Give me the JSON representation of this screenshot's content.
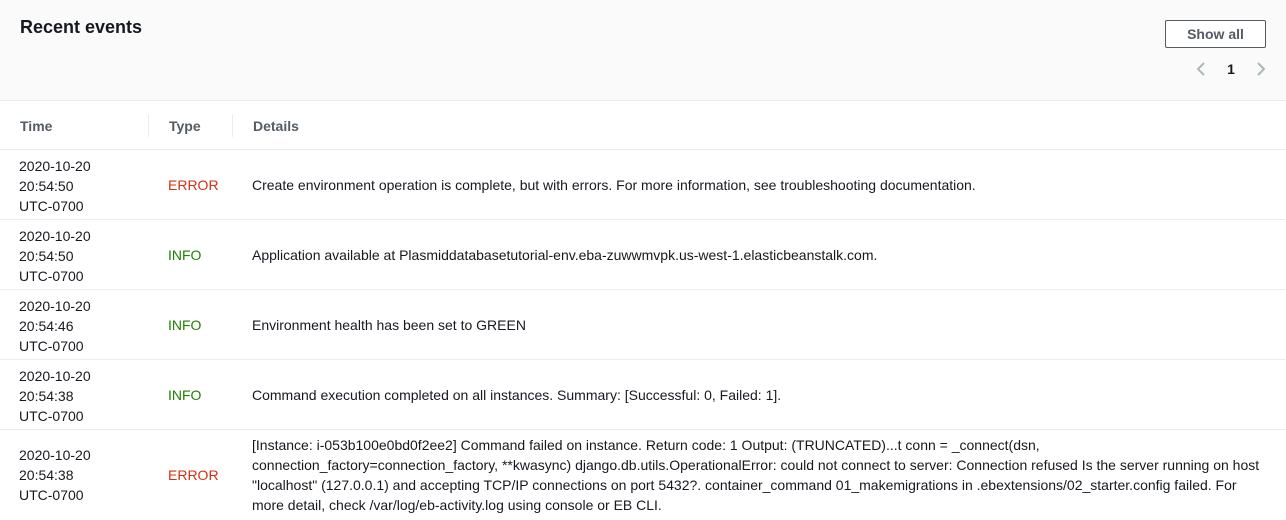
{
  "panel": {
    "title": "Recent events",
    "show_all_label": "Show all",
    "pagination": {
      "current_page": "1"
    }
  },
  "table": {
    "columns": [
      "Time",
      "Type",
      "Details"
    ],
    "rows": [
      {
        "date": "2020-10-20",
        "time": "20:54:50",
        "tz": "UTC-0700",
        "type": "ERROR",
        "details": "Create environment operation is complete, but with errors. For more information, see troubleshooting documentation."
      },
      {
        "date": "2020-10-20",
        "time": "20:54:50",
        "tz": "UTC-0700",
        "type": "INFO",
        "details": "Application available at Plasmiddatabasetutorial-env.eba-zuwwmvpk.us-west-1.elasticbeanstalk.com."
      },
      {
        "date": "2020-10-20",
        "time": "20:54:46",
        "tz": "UTC-0700",
        "type": "INFO",
        "details": "Environment health has been set to GREEN"
      },
      {
        "date": "2020-10-20",
        "time": "20:54:38",
        "tz": "UTC-0700",
        "type": "INFO",
        "details": "Command execution completed on all instances. Summary: [Successful: 0, Failed: 1]."
      },
      {
        "date": "2020-10-20",
        "time": "20:54:38",
        "tz": "UTC-0700",
        "type": "ERROR",
        "details": "[Instance: i-053b100e0bd0f2ee2] Command failed on instance. Return code: 1 Output: (TRUNCATED)...t conn = _connect(dsn, connection_factory=connection_factory, **kwasync) django.db.utils.OperationalError: could not connect to server: Connection refused Is the server running on host \"localhost\" (127.0.0.1) and accepting TCP/IP connections on port 5432?. container_command 01_makemigrations in .ebextensions/02_starter.config failed. For more detail, check /var/log/eb-activity.log using console or EB CLI."
      }
    ]
  },
  "colors": {
    "error": "#d13212",
    "info": "#1d8102",
    "header_bg": "#fafafa",
    "border": "#eaeded"
  },
  "icons": {
    "prev": "chevron-left-icon",
    "next": "chevron-right-icon"
  }
}
